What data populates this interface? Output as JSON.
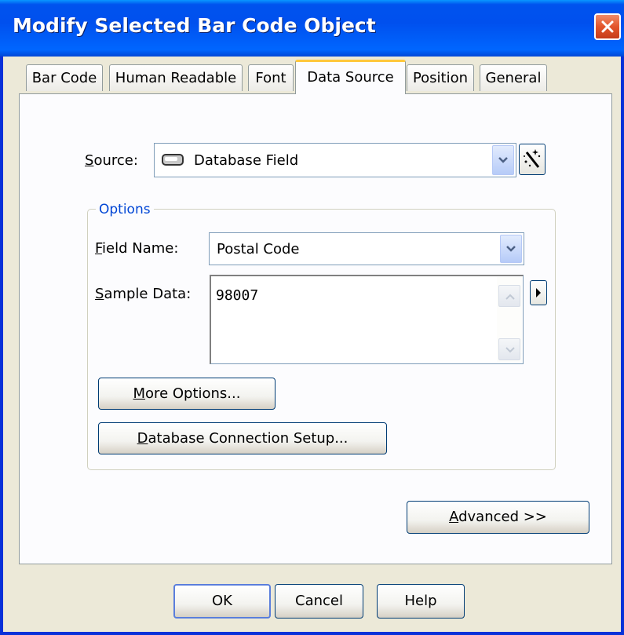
{
  "window": {
    "title": "Modify Selected Bar Code Object"
  },
  "tabs": [
    {
      "label": "Bar Code"
    },
    {
      "label": "Human Readable"
    },
    {
      "label": "Font"
    },
    {
      "label": "Data Source",
      "active": true
    },
    {
      "label": "Position"
    },
    {
      "label": "General"
    }
  ],
  "source": {
    "label_mnemonic": "S",
    "label_rest": "ource:",
    "value": "Database Field",
    "icon": "database-field-icon"
  },
  "options": {
    "group_title": "Options",
    "field_name": {
      "label_mnemonic": "F",
      "label_rest": "ield Name:",
      "value": "Postal Code"
    },
    "sample_data": {
      "label_mnemonic": "S",
      "label_rest": "ample Data:",
      "value": "98007"
    },
    "more_options": {
      "mnemonic": "M",
      "rest": "ore Options..."
    },
    "db_setup": {
      "mnemonic": "D",
      "rest": "atabase Connection Setup..."
    }
  },
  "advanced": {
    "mnemonic": "A",
    "rest": "dvanced >>"
  },
  "footer": {
    "ok": "OK",
    "cancel": "Cancel",
    "help": "Help"
  },
  "colors": {
    "titlebar": "#0054e3",
    "panel": "#fcfcfe",
    "face": "#ece9d8",
    "group_title": "#0046d5",
    "tab_highlight": "#ffc83c"
  }
}
